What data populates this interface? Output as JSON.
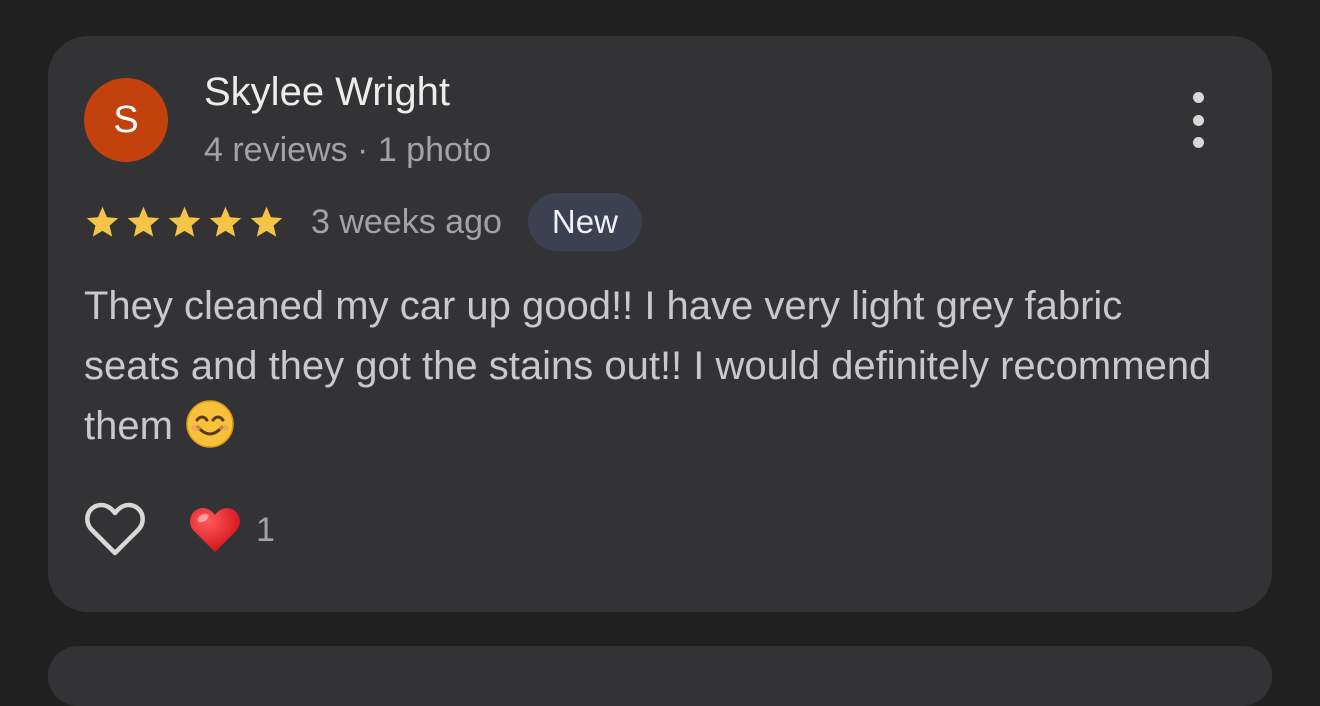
{
  "review": {
    "author": {
      "avatar_letter": "S",
      "avatar_color": "#c2410c",
      "name": "Skylee Wright",
      "meta": "4 reviews · 1 photo"
    },
    "rating": 5,
    "rating_max": 5,
    "star_color": "#f6c445",
    "time": "3 weeks ago",
    "badge": "New",
    "text": "They cleaned my car up good!! I have very light grey fabric seats and they got the stains out!! I would definitely recommend them",
    "text_emoji": "smiling-face-emoji",
    "like_icon": "heart-outline-icon",
    "reactions": {
      "icon": "red-heart-icon",
      "count": "1"
    },
    "more_icon": "more-vertical-icon"
  }
}
